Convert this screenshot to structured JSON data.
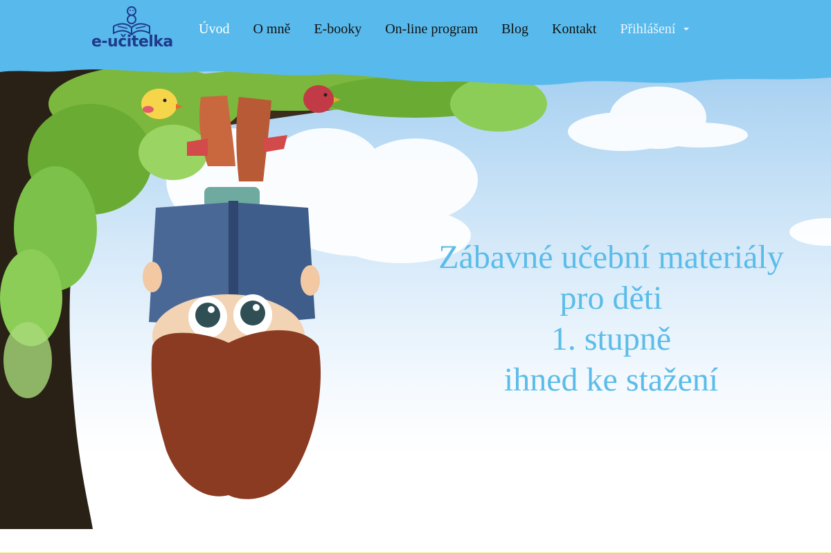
{
  "brand": {
    "logo_text": "e-učitelka",
    "logo_icon": "book-reader-icon",
    "colors": {
      "header_blue": "#58baec",
      "logo_blue": "#1f3a8c",
      "headline_blue": "#5cbce9"
    }
  },
  "nav": {
    "items": [
      {
        "label": "Úvod",
        "active": true
      },
      {
        "label": "O mně"
      },
      {
        "label": "E-booky"
      },
      {
        "label": "On-line program"
      },
      {
        "label": "Blog"
      },
      {
        "label": "Kontakt"
      }
    ],
    "login": {
      "label": "Přihlášení",
      "icon": "caret-down-icon"
    }
  },
  "hero": {
    "headline_lines": [
      "Zábavné učební materiály",
      "pro děti",
      "1. stupně",
      "ihned ke stažení"
    ],
    "illustration": "boy-hanging-upside-down-from-tree-reading-book"
  }
}
